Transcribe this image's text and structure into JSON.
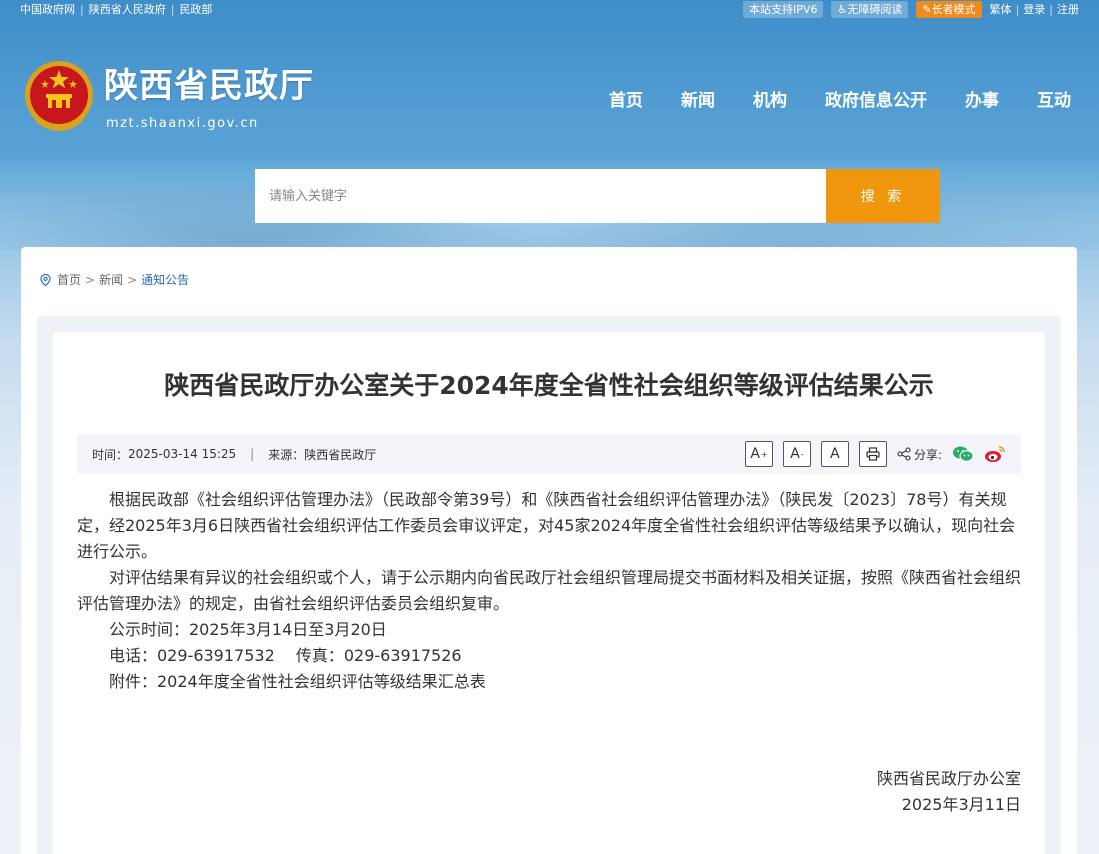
{
  "topbar": {
    "links": [
      "中国政府网",
      "陕西省人民政府",
      "民政部"
    ],
    "ipv6": "本站支持IPV6",
    "accessibility": "无障碍阅读",
    "elder_mode": "长者模式",
    "traditional": "繁体",
    "login": "登录",
    "register": "注册"
  },
  "header": {
    "site_title": "陕西省民政厅",
    "site_domain": "mzt.shaanxi.gov.cn",
    "nav": [
      "首页",
      "新闻",
      "机构",
      "政府信息公开",
      "办事",
      "互动"
    ]
  },
  "search": {
    "placeholder": "请输入关键字",
    "button": "搜 索"
  },
  "breadcrumb": {
    "home": "首页",
    "news": "新闻",
    "current": "通知公告"
  },
  "article": {
    "title": "陕西省民政厅办公室关于2024年度全省性社会组织等级评估结果公示",
    "time_label": "时间：",
    "time_value": "2025-03-14 15:25",
    "source_label": "来源：",
    "source_value": "陕西省民政厅",
    "share_label": "分享:",
    "paragraphs": [
      "根据民政部《社会组织评估管理办法》（民政部令第39号）和《陕西省社会组织评估管理办法》（陕民发〔2023〕78号）有关规定，经2025年3月6日陕西省社会组织评估工作委员会审议评定，对45家2024年度全省性社会组织评估等级结果予以确认，现向社会进行公示。",
      "对评估结果有异议的社会组织或个人，请于公示期内向省民政厅社会组织管理局提交书面材料及相关证据，按照《陕西省社会组织评估管理办法》的规定，由省社会组织评估委员会组织复审。",
      "公示时间：2025年3月14日至3月20日",
      "电话：029-63917532　 传真：029-63917526",
      "附件：2024年度全省性社会组织评估等级结果汇总表"
    ],
    "sign_org": "陕西省民政厅办公室",
    "sign_date": "2025年3月11日"
  },
  "colors": {
    "accent_orange": "#f0960f",
    "link_blue": "#2a6db5"
  }
}
